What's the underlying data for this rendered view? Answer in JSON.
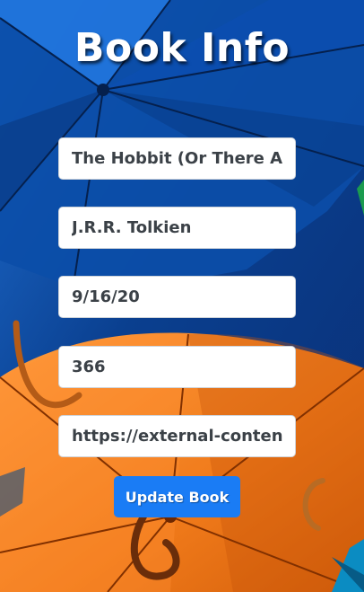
{
  "page": {
    "title": "Book Info"
  },
  "form": {
    "title_value": "The Hobbit (Or There And Back Again)",
    "author_value": "J.R.R. Tolkien",
    "date_value": "9/16/20",
    "pages_value": "366",
    "url_value": "https://external-content.d",
    "submit_label": "Update Book"
  },
  "colors": {
    "button": "#1a7cf5",
    "background_blue": "#0d3f8f",
    "background_orange": "#f07a1a"
  }
}
